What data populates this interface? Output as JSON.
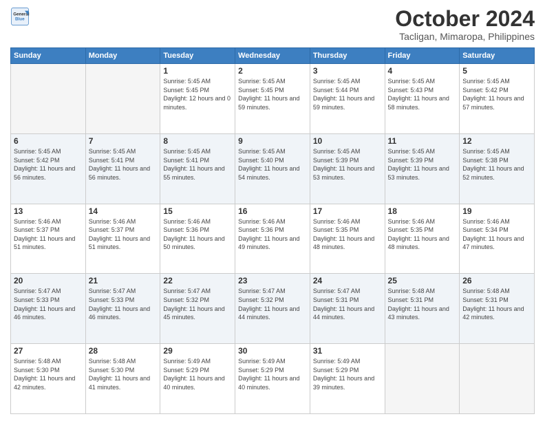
{
  "header": {
    "logo_line1": "General",
    "logo_line2": "Blue",
    "title": "October 2024",
    "subtitle": "Tacligan, Mimaropa, Philippines"
  },
  "days_of_week": [
    "Sunday",
    "Monday",
    "Tuesday",
    "Wednesday",
    "Thursday",
    "Friday",
    "Saturday"
  ],
  "weeks": [
    [
      {
        "day": "",
        "sunrise": "",
        "sunset": "",
        "daylight": "",
        "empty": true
      },
      {
        "day": "",
        "sunrise": "",
        "sunset": "",
        "daylight": "",
        "empty": true
      },
      {
        "day": "1",
        "sunrise": "Sunrise: 5:45 AM",
        "sunset": "Sunset: 5:45 PM",
        "daylight": "Daylight: 12 hours and 0 minutes."
      },
      {
        "day": "2",
        "sunrise": "Sunrise: 5:45 AM",
        "sunset": "Sunset: 5:45 PM",
        "daylight": "Daylight: 11 hours and 59 minutes."
      },
      {
        "day": "3",
        "sunrise": "Sunrise: 5:45 AM",
        "sunset": "Sunset: 5:44 PM",
        "daylight": "Daylight: 11 hours and 59 minutes."
      },
      {
        "day": "4",
        "sunrise": "Sunrise: 5:45 AM",
        "sunset": "Sunset: 5:43 PM",
        "daylight": "Daylight: 11 hours and 58 minutes."
      },
      {
        "day": "5",
        "sunrise": "Sunrise: 5:45 AM",
        "sunset": "Sunset: 5:42 PM",
        "daylight": "Daylight: 11 hours and 57 minutes."
      }
    ],
    [
      {
        "day": "6",
        "sunrise": "Sunrise: 5:45 AM",
        "sunset": "Sunset: 5:42 PM",
        "daylight": "Daylight: 11 hours and 56 minutes."
      },
      {
        "day": "7",
        "sunrise": "Sunrise: 5:45 AM",
        "sunset": "Sunset: 5:41 PM",
        "daylight": "Daylight: 11 hours and 56 minutes."
      },
      {
        "day": "8",
        "sunrise": "Sunrise: 5:45 AM",
        "sunset": "Sunset: 5:41 PM",
        "daylight": "Daylight: 11 hours and 55 minutes."
      },
      {
        "day": "9",
        "sunrise": "Sunrise: 5:45 AM",
        "sunset": "Sunset: 5:40 PM",
        "daylight": "Daylight: 11 hours and 54 minutes."
      },
      {
        "day": "10",
        "sunrise": "Sunrise: 5:45 AM",
        "sunset": "Sunset: 5:39 PM",
        "daylight": "Daylight: 11 hours and 53 minutes."
      },
      {
        "day": "11",
        "sunrise": "Sunrise: 5:45 AM",
        "sunset": "Sunset: 5:39 PM",
        "daylight": "Daylight: 11 hours and 53 minutes."
      },
      {
        "day": "12",
        "sunrise": "Sunrise: 5:45 AM",
        "sunset": "Sunset: 5:38 PM",
        "daylight": "Daylight: 11 hours and 52 minutes."
      }
    ],
    [
      {
        "day": "13",
        "sunrise": "Sunrise: 5:46 AM",
        "sunset": "Sunset: 5:37 PM",
        "daylight": "Daylight: 11 hours and 51 minutes."
      },
      {
        "day": "14",
        "sunrise": "Sunrise: 5:46 AM",
        "sunset": "Sunset: 5:37 PM",
        "daylight": "Daylight: 11 hours and 51 minutes."
      },
      {
        "day": "15",
        "sunrise": "Sunrise: 5:46 AM",
        "sunset": "Sunset: 5:36 PM",
        "daylight": "Daylight: 11 hours and 50 minutes."
      },
      {
        "day": "16",
        "sunrise": "Sunrise: 5:46 AM",
        "sunset": "Sunset: 5:36 PM",
        "daylight": "Daylight: 11 hours and 49 minutes."
      },
      {
        "day": "17",
        "sunrise": "Sunrise: 5:46 AM",
        "sunset": "Sunset: 5:35 PM",
        "daylight": "Daylight: 11 hours and 48 minutes."
      },
      {
        "day": "18",
        "sunrise": "Sunrise: 5:46 AM",
        "sunset": "Sunset: 5:35 PM",
        "daylight": "Daylight: 11 hours and 48 minutes."
      },
      {
        "day": "19",
        "sunrise": "Sunrise: 5:46 AM",
        "sunset": "Sunset: 5:34 PM",
        "daylight": "Daylight: 11 hours and 47 minutes."
      }
    ],
    [
      {
        "day": "20",
        "sunrise": "Sunrise: 5:47 AM",
        "sunset": "Sunset: 5:33 PM",
        "daylight": "Daylight: 11 hours and 46 minutes."
      },
      {
        "day": "21",
        "sunrise": "Sunrise: 5:47 AM",
        "sunset": "Sunset: 5:33 PM",
        "daylight": "Daylight: 11 hours and 46 minutes."
      },
      {
        "day": "22",
        "sunrise": "Sunrise: 5:47 AM",
        "sunset": "Sunset: 5:32 PM",
        "daylight": "Daylight: 11 hours and 45 minutes."
      },
      {
        "day": "23",
        "sunrise": "Sunrise: 5:47 AM",
        "sunset": "Sunset: 5:32 PM",
        "daylight": "Daylight: 11 hours and 44 minutes."
      },
      {
        "day": "24",
        "sunrise": "Sunrise: 5:47 AM",
        "sunset": "Sunset: 5:31 PM",
        "daylight": "Daylight: 11 hours and 44 minutes."
      },
      {
        "day": "25",
        "sunrise": "Sunrise: 5:48 AM",
        "sunset": "Sunset: 5:31 PM",
        "daylight": "Daylight: 11 hours and 43 minutes."
      },
      {
        "day": "26",
        "sunrise": "Sunrise: 5:48 AM",
        "sunset": "Sunset: 5:31 PM",
        "daylight": "Daylight: 11 hours and 42 minutes."
      }
    ],
    [
      {
        "day": "27",
        "sunrise": "Sunrise: 5:48 AM",
        "sunset": "Sunset: 5:30 PM",
        "daylight": "Daylight: 11 hours and 42 minutes."
      },
      {
        "day": "28",
        "sunrise": "Sunrise: 5:48 AM",
        "sunset": "Sunset: 5:30 PM",
        "daylight": "Daylight: 11 hours and 41 minutes."
      },
      {
        "day": "29",
        "sunrise": "Sunrise: 5:49 AM",
        "sunset": "Sunset: 5:29 PM",
        "daylight": "Daylight: 11 hours and 40 minutes."
      },
      {
        "day": "30",
        "sunrise": "Sunrise: 5:49 AM",
        "sunset": "Sunset: 5:29 PM",
        "daylight": "Daylight: 11 hours and 40 minutes."
      },
      {
        "day": "31",
        "sunrise": "Sunrise: 5:49 AM",
        "sunset": "Sunset: 5:29 PM",
        "daylight": "Daylight: 11 hours and 39 minutes."
      },
      {
        "day": "",
        "sunrise": "",
        "sunset": "",
        "daylight": "",
        "empty": true
      },
      {
        "day": "",
        "sunrise": "",
        "sunset": "",
        "daylight": "",
        "empty": true
      }
    ]
  ]
}
